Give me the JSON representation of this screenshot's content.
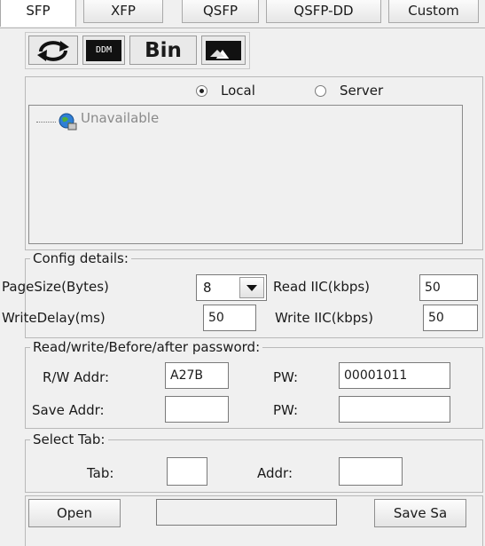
{
  "tabs": [
    "SFP",
    "XFP",
    "QSFP",
    "QSFP-DD",
    "Custom"
  ],
  "toolbar": {
    "ddm_label": "DDM",
    "bin_label": "Bin"
  },
  "source": {
    "local_label": "Local",
    "server_label": "Server",
    "selected": "Local"
  },
  "tree": {
    "node_label": "Unavailable"
  },
  "config": {
    "legend": "Config details:",
    "pagesize_label": "PageSize(Bytes)",
    "pagesize_value": "8",
    "read_iic_label": "Read IIC(kbps)",
    "read_iic_value": "50",
    "writedelay_label": "WriteDelay(ms)",
    "writedelay_value": "50",
    "write_iic_label": "Write IIC(kbps)",
    "write_iic_value": "50"
  },
  "password": {
    "legend": "Read/write/Before/after password:",
    "rw_addr_label": "R/W Addr:",
    "rw_addr_value": "A27B",
    "pw1_label": "PW:",
    "pw1_value": "00001011",
    "save_addr_label": "Save Addr:",
    "save_addr_value": "",
    "pw2_label": "PW:",
    "pw2_value": ""
  },
  "select_tab": {
    "legend": "Select Tab:",
    "tab_label": "Tab:",
    "tab_value": "",
    "addr_label": "Addr:",
    "addr_value": ""
  },
  "footer": {
    "open_label": "Open",
    "path_value": "",
    "save_label": "Save Sa"
  },
  "icons": [
    "refresh-icon",
    "ddm-icon",
    "bin-icon",
    "write-icon",
    "globe-icon",
    "dropdown-arrow-icon"
  ]
}
